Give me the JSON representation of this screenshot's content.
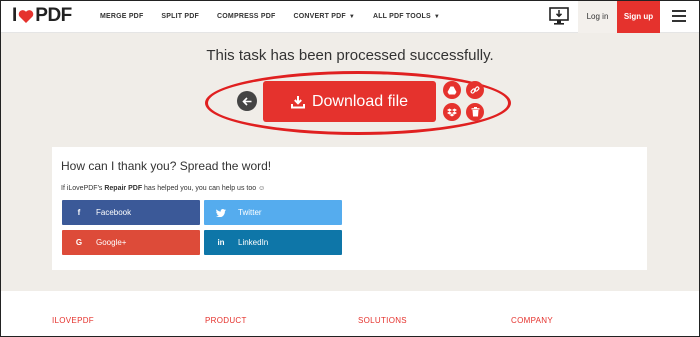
{
  "header": {
    "logo": {
      "prefix": "I",
      "suffix": "PDF"
    },
    "nav": [
      {
        "label": "MERGE PDF"
      },
      {
        "label": "SPLIT PDF"
      },
      {
        "label": "COMPRESS PDF"
      },
      {
        "label": "CONVERT PDF",
        "caret": "▼"
      },
      {
        "label": "ALL PDF TOOLS",
        "caret": "▼"
      }
    ],
    "login_label": "Log in",
    "signup_label": "Sign up"
  },
  "main": {
    "success_message": "This task has been processed successfully.",
    "download_label": "Download file"
  },
  "share": {
    "title": "How can I thank you? Spread the word!",
    "subtitle_pre": "If iLovePDF's ",
    "subtitle_tool": "Repair PDF",
    "subtitle_post": " has helped you, you can help us too ☺",
    "buttons": {
      "facebook": "Facebook",
      "twitter": "Twitter",
      "google": "Google+",
      "linkedin": "LinkedIn"
    }
  },
  "footer": {
    "columns": [
      "ILOVEPDF",
      "PRODUCT",
      "SOLUTIONS",
      "COMPANY"
    ]
  },
  "colors": {
    "brand_red": "#e5322d",
    "facebook": "#3b5998",
    "twitter": "#55acee",
    "google": "#dd4b39",
    "linkedin": "#0e76a8"
  }
}
